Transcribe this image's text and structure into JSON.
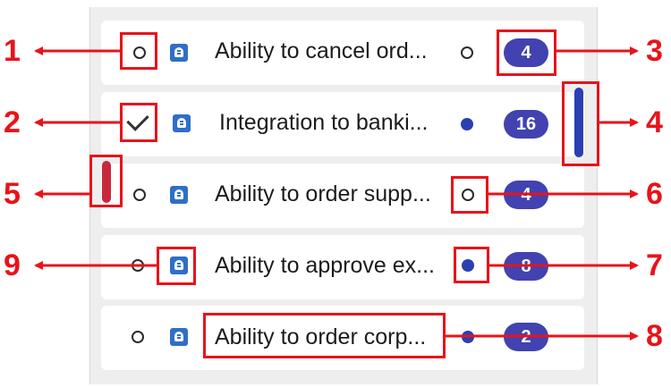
{
  "rows": [
    {
      "status": "unchecked",
      "title": "Ability to cancel ord...",
      "priority": "",
      "milestone": "empty",
      "count": "4"
    },
    {
      "status": "checked",
      "title": "Integration to banki...",
      "priority": "blue",
      "milestone": "filled",
      "count": "16"
    },
    {
      "status": "unchecked",
      "title": "Ability to order supp...",
      "priority": "red",
      "milestone": "empty",
      "count": "4"
    },
    {
      "status": "unchecked",
      "title": "Ability to approve ex...",
      "priority": "",
      "milestone": "filled",
      "count": "8"
    },
    {
      "status": "unchecked",
      "title": "Ability to order corp...",
      "priority": "",
      "milestone": "filled",
      "count": "2"
    }
  ],
  "callouts": [
    "1",
    "2",
    "3",
    "4",
    "5",
    "6",
    "7",
    "8",
    "9"
  ],
  "colors": {
    "callout": "#e8131a",
    "badge": "#4242b0",
    "dot": "#2a3fb3",
    "priority_blue": "#2a3fb3",
    "priority_red": "#c8283c",
    "type_icon": "#2f6fc7"
  },
  "icons": {
    "type": "backlog-item-icon",
    "milestone": "milestone-dot-icon",
    "status": "checkbox-icon"
  }
}
